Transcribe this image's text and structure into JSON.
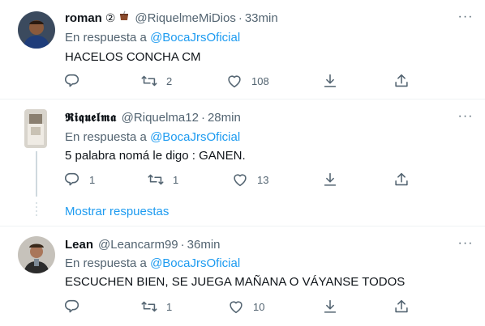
{
  "tweets": [
    {
      "name": "roman",
      "badge": "②",
      "handle": "@RiquelmeMiDios",
      "separator": "·",
      "time": "33min",
      "reply_prefix": "En respuesta a",
      "reply_mention": "@BocaJrsOficial",
      "text": "HACELOS CONCHA CM",
      "replies": "",
      "retweets": "2",
      "likes": "108"
    },
    {
      "name": "𝕽𝖎𝖖𝖚𝖊𝖑𝖒𝖆",
      "handle": "@Riquelma12",
      "separator": "·",
      "time": "28min",
      "reply_prefix": "En respuesta a",
      "reply_mention": "@BocaJrsOficial",
      "text": "5 palabra nomá le digo : GANEN.",
      "replies": "1",
      "retweets": "1",
      "likes": "13"
    },
    {
      "name": "Lean",
      "handle": "@Leancarm99",
      "separator": "·",
      "time": "36min",
      "reply_prefix": "En respuesta a",
      "reply_mention": "@BocaJrsOficial",
      "text": "ESCUCHEN BIEN, SE JUEGA MAÑANA O VÁYANSE TODOS",
      "replies": "",
      "retweets": "1",
      "likes": "10"
    }
  ],
  "show_replies_label": "Mostrar respuestas",
  "more_label": "···",
  "colors": {
    "accent": "#1d9bf0",
    "secondary": "#536471",
    "divider": "#eff3f4"
  },
  "icons": [
    "reply-icon",
    "retweet-icon",
    "like-icon",
    "download-icon",
    "share-icon",
    "more-icon",
    "mate-icon"
  ]
}
